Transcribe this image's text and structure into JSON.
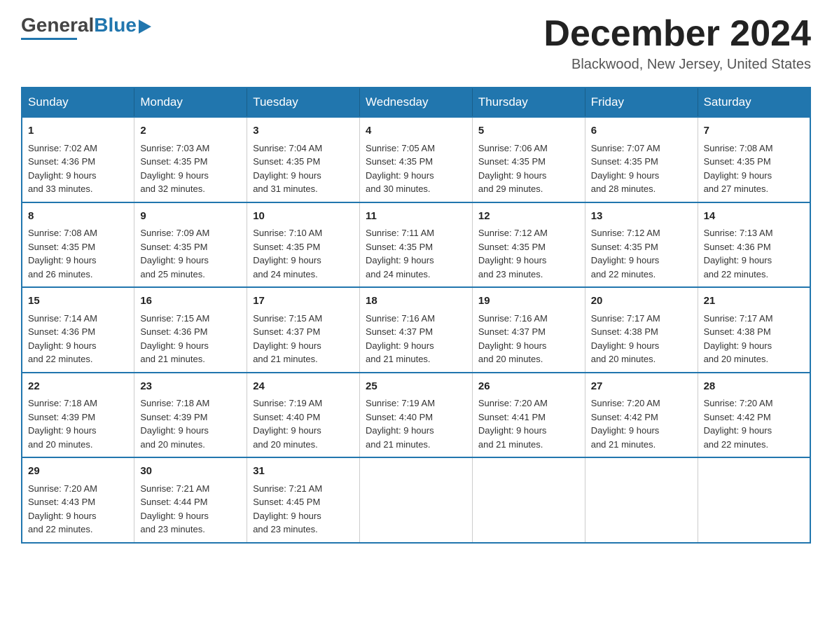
{
  "header": {
    "logo_general": "General",
    "logo_blue": "Blue",
    "month_title": "December 2024",
    "location": "Blackwood, New Jersey, United States"
  },
  "weekdays": [
    "Sunday",
    "Monday",
    "Tuesday",
    "Wednesday",
    "Thursday",
    "Friday",
    "Saturday"
  ],
  "weeks": [
    [
      {
        "day": "1",
        "sunrise": "7:02 AM",
        "sunset": "4:36 PM",
        "daylight": "9 hours and 33 minutes."
      },
      {
        "day": "2",
        "sunrise": "7:03 AM",
        "sunset": "4:35 PM",
        "daylight": "9 hours and 32 minutes."
      },
      {
        "day": "3",
        "sunrise": "7:04 AM",
        "sunset": "4:35 PM",
        "daylight": "9 hours and 31 minutes."
      },
      {
        "day": "4",
        "sunrise": "7:05 AM",
        "sunset": "4:35 PM",
        "daylight": "9 hours and 30 minutes."
      },
      {
        "day": "5",
        "sunrise": "7:06 AM",
        "sunset": "4:35 PM",
        "daylight": "9 hours and 29 minutes."
      },
      {
        "day": "6",
        "sunrise": "7:07 AM",
        "sunset": "4:35 PM",
        "daylight": "9 hours and 28 minutes."
      },
      {
        "day": "7",
        "sunrise": "7:08 AM",
        "sunset": "4:35 PM",
        "daylight": "9 hours and 27 minutes."
      }
    ],
    [
      {
        "day": "8",
        "sunrise": "7:08 AM",
        "sunset": "4:35 PM",
        "daylight": "9 hours and 26 minutes."
      },
      {
        "day": "9",
        "sunrise": "7:09 AM",
        "sunset": "4:35 PM",
        "daylight": "9 hours and 25 minutes."
      },
      {
        "day": "10",
        "sunrise": "7:10 AM",
        "sunset": "4:35 PM",
        "daylight": "9 hours and 24 minutes."
      },
      {
        "day": "11",
        "sunrise": "7:11 AM",
        "sunset": "4:35 PM",
        "daylight": "9 hours and 24 minutes."
      },
      {
        "day": "12",
        "sunrise": "7:12 AM",
        "sunset": "4:35 PM",
        "daylight": "9 hours and 23 minutes."
      },
      {
        "day": "13",
        "sunrise": "7:12 AM",
        "sunset": "4:35 PM",
        "daylight": "9 hours and 22 minutes."
      },
      {
        "day": "14",
        "sunrise": "7:13 AM",
        "sunset": "4:36 PM",
        "daylight": "9 hours and 22 minutes."
      }
    ],
    [
      {
        "day": "15",
        "sunrise": "7:14 AM",
        "sunset": "4:36 PM",
        "daylight": "9 hours and 22 minutes."
      },
      {
        "day": "16",
        "sunrise": "7:15 AM",
        "sunset": "4:36 PM",
        "daylight": "9 hours and 21 minutes."
      },
      {
        "day": "17",
        "sunrise": "7:15 AM",
        "sunset": "4:37 PM",
        "daylight": "9 hours and 21 minutes."
      },
      {
        "day": "18",
        "sunrise": "7:16 AM",
        "sunset": "4:37 PM",
        "daylight": "9 hours and 21 minutes."
      },
      {
        "day": "19",
        "sunrise": "7:16 AM",
        "sunset": "4:37 PM",
        "daylight": "9 hours and 20 minutes."
      },
      {
        "day": "20",
        "sunrise": "7:17 AM",
        "sunset": "4:38 PM",
        "daylight": "9 hours and 20 minutes."
      },
      {
        "day": "21",
        "sunrise": "7:17 AM",
        "sunset": "4:38 PM",
        "daylight": "9 hours and 20 minutes."
      }
    ],
    [
      {
        "day": "22",
        "sunrise": "7:18 AM",
        "sunset": "4:39 PM",
        "daylight": "9 hours and 20 minutes."
      },
      {
        "day": "23",
        "sunrise": "7:18 AM",
        "sunset": "4:39 PM",
        "daylight": "9 hours and 20 minutes."
      },
      {
        "day": "24",
        "sunrise": "7:19 AM",
        "sunset": "4:40 PM",
        "daylight": "9 hours and 20 minutes."
      },
      {
        "day": "25",
        "sunrise": "7:19 AM",
        "sunset": "4:40 PM",
        "daylight": "9 hours and 21 minutes."
      },
      {
        "day": "26",
        "sunrise": "7:20 AM",
        "sunset": "4:41 PM",
        "daylight": "9 hours and 21 minutes."
      },
      {
        "day": "27",
        "sunrise": "7:20 AM",
        "sunset": "4:42 PM",
        "daylight": "9 hours and 21 minutes."
      },
      {
        "day": "28",
        "sunrise": "7:20 AM",
        "sunset": "4:42 PM",
        "daylight": "9 hours and 22 minutes."
      }
    ],
    [
      {
        "day": "29",
        "sunrise": "7:20 AM",
        "sunset": "4:43 PM",
        "daylight": "9 hours and 22 minutes."
      },
      {
        "day": "30",
        "sunrise": "7:21 AM",
        "sunset": "4:44 PM",
        "daylight": "9 hours and 23 minutes."
      },
      {
        "day": "31",
        "sunrise": "7:21 AM",
        "sunset": "4:45 PM",
        "daylight": "9 hours and 23 minutes."
      },
      null,
      null,
      null,
      null
    ]
  ],
  "labels": {
    "sunrise": "Sunrise:",
    "sunset": "Sunset:",
    "daylight": "Daylight:"
  }
}
